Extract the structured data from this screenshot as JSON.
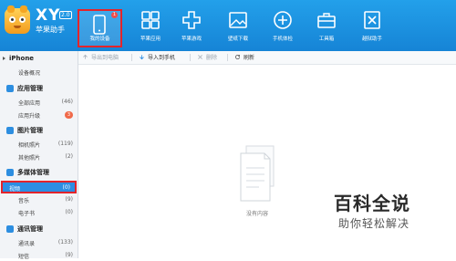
{
  "app": {
    "logo_text": "XY",
    "version": "2.0",
    "subtitle": "苹果助手"
  },
  "toolbar_main": [
    {
      "label": "我的设备",
      "icon": "phone-icon",
      "active": true,
      "badge": "1"
    },
    {
      "label": "苹果应用",
      "icon": "apps-icon"
    },
    {
      "label": "苹果游戏",
      "icon": "gamepad-icon"
    },
    {
      "label": "壁纸下载",
      "icon": "image-icon"
    },
    {
      "label": "手机体检",
      "icon": "plus-circle-icon"
    },
    {
      "label": "工具箱",
      "icon": "toolbox-icon"
    },
    {
      "label": "越狱助手",
      "icon": "unlock-icon"
    }
  ],
  "sidebar": {
    "device": {
      "title": "iPhone",
      "items": [
        {
          "label": "设备概况"
        }
      ]
    },
    "apps": {
      "title": "应用管理",
      "items": [
        {
          "label": "全部应用",
          "count": "(46)"
        },
        {
          "label": "应用升级",
          "count": "3"
        }
      ]
    },
    "photos": {
      "title": "图片管理",
      "items": [
        {
          "label": "相机照片",
          "count": "(119)"
        },
        {
          "label": "其他照片",
          "count": "(2)"
        }
      ]
    },
    "media": {
      "title": "多媒体管理",
      "items": [
        {
          "label": "视频",
          "count": "(0)"
        },
        {
          "label": "音乐",
          "count": "(9)"
        },
        {
          "label": "电子书",
          "count": "(0)"
        }
      ]
    },
    "comm": {
      "title": "通讯管理",
      "items": [
        {
          "label": "通讯录",
          "count": "(133)"
        },
        {
          "label": "短信",
          "count": "(9)"
        }
      ]
    }
  },
  "content_toolbar": {
    "export": "导出到电脑",
    "import": "导入到手机",
    "delete": "删除",
    "refresh": "刷新"
  },
  "empty_state": {
    "text": "没有内容"
  },
  "watermark": {
    "big": "百科全说",
    "small": "助你轻松解决"
  },
  "colors": {
    "topbar": "#1a8fe0",
    "selected": "#2c8ee3",
    "highlight_border": "#e3242b"
  }
}
